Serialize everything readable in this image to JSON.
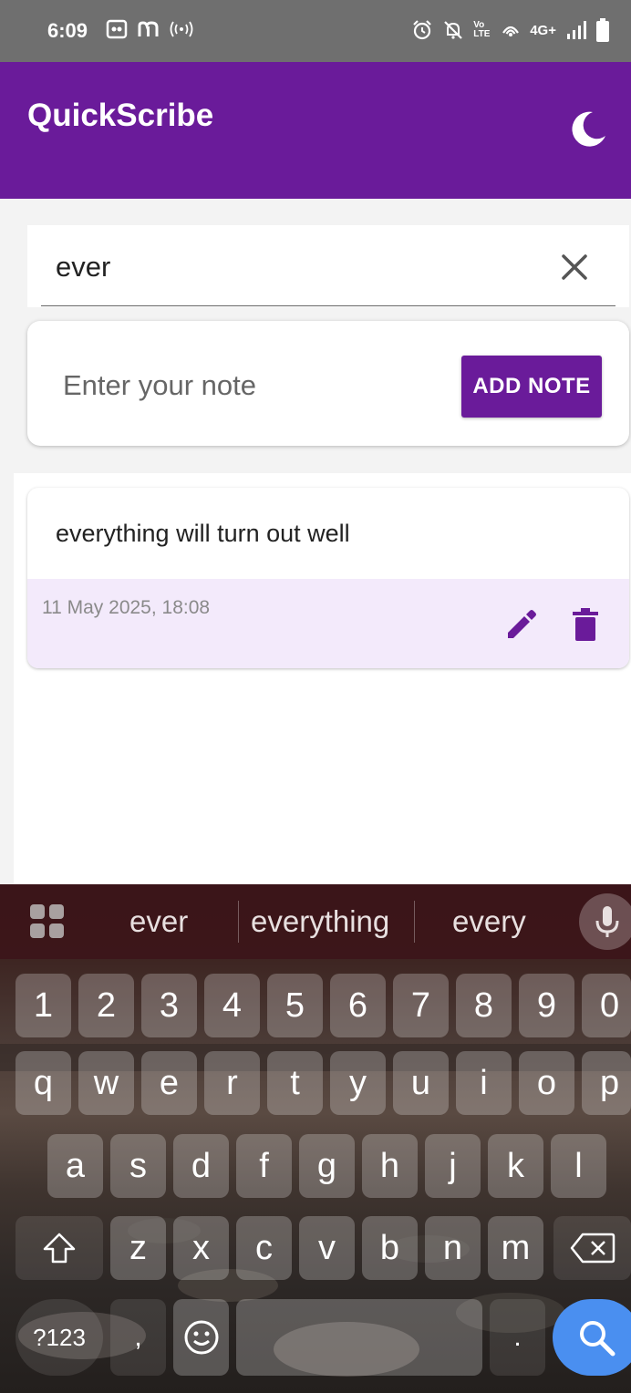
{
  "status_bar": {
    "time": "6:09",
    "left_icons": [
      "screenshot-icon",
      "m-app-icon",
      "hotspot-icon"
    ],
    "volte": "Vo LTE",
    "network": "4G+",
    "right_icons": [
      "alarm-icon",
      "mute-icon",
      "wifi-calling-icon",
      "signal-icon",
      "battery-icon"
    ]
  },
  "app_bar": {
    "title": "QuickScribe",
    "theme_icon": "moon-icon",
    "color": "#6a1b9a"
  },
  "search": {
    "value": "ever",
    "clear_icon": "close-icon"
  },
  "note_input": {
    "placeholder": "Enter your note",
    "add_label": "ADD NOTE"
  },
  "notes": [
    {
      "text": "everything will turn out well",
      "date": "11 May 2025, 18:08",
      "edit_icon": "pencil-icon",
      "delete_icon": "trash-icon"
    }
  ],
  "keyboard": {
    "suggestions": [
      "ever",
      "everything",
      "every"
    ],
    "number_row": [
      "1",
      "2",
      "3",
      "4",
      "5",
      "6",
      "7",
      "8",
      "9",
      "0"
    ],
    "row1": [
      "q",
      "w",
      "e",
      "r",
      "t",
      "y",
      "u",
      "i",
      "o",
      "p"
    ],
    "row2": [
      "a",
      "s",
      "d",
      "f",
      "g",
      "h",
      "j",
      "k",
      "l"
    ],
    "row3": [
      "z",
      "x",
      "c",
      "v",
      "b",
      "n",
      "m"
    ],
    "symbols_label": "?123",
    "comma_label": ",",
    "period_label": ".",
    "accent_color": "#4a8ff0"
  }
}
